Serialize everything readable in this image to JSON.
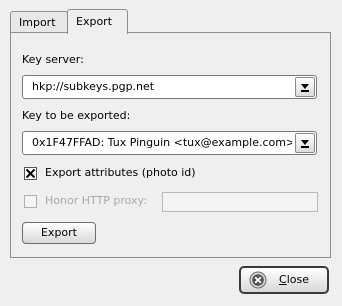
{
  "tabs": [
    {
      "label": "Import"
    },
    {
      "label": "Export"
    }
  ],
  "export_panel": {
    "key_server_label": "Key server:",
    "key_server_value": "hkp://subkeys.pgp.net",
    "key_to_export_label": "Key to be exported:",
    "key_to_export_value": "0x1F47FFAD: Tux Pinguin <tux@example.com>",
    "export_attributes_label": "Export attributes (photo id)",
    "export_attributes_checked": true,
    "honor_proxy_label": "Honor HTTP proxy:",
    "honor_proxy_checked": false,
    "honor_proxy_value": "",
    "export_button_label": "Export"
  },
  "footer": {
    "close_button_label": "Close"
  },
  "icons": {
    "dropdown": "chevron-down-icon",
    "close": "close-icon"
  }
}
